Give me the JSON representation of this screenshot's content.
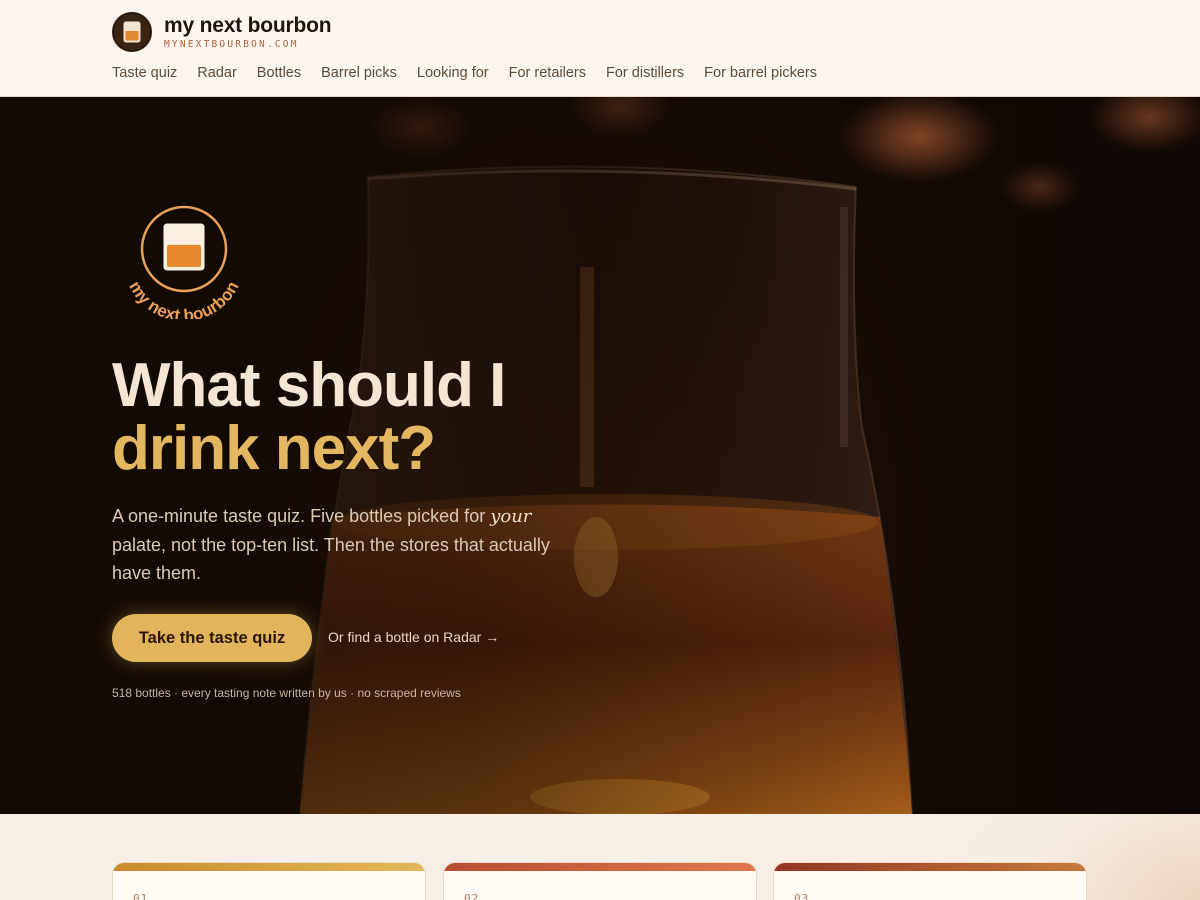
{
  "brand": {
    "name": "my next bourbon",
    "domain": "MYNEXTBOURBON.COM",
    "badge_text": "my next bourbon"
  },
  "nav": {
    "items": [
      {
        "label": "Taste quiz"
      },
      {
        "label": "Radar"
      },
      {
        "label": "Bottles"
      },
      {
        "label": "Barrel picks"
      },
      {
        "label": "Looking for"
      },
      {
        "label": "For retailers"
      },
      {
        "label": "For distillers"
      },
      {
        "label": "For barrel pickers"
      }
    ]
  },
  "hero": {
    "title_line1": "What should I",
    "title_line2": "drink next?",
    "subtitle_before": "A one-minute taste quiz. Five bottles picked for ",
    "subtitle_emphasis": "your",
    "subtitle_after": " palate, not the top-ten list. Then the stores that actually have them.",
    "cta_label": "Take the taste quiz",
    "secondary_link": "Or find a bottle on Radar →",
    "stats": "518 bottles · every tasting note written by us · no scraped reviews"
  },
  "cards": [
    {
      "number": "01",
      "accent": "#d9a444"
    },
    {
      "number": "02",
      "accent": "#c96a44"
    },
    {
      "number": "03",
      "accent": "#a84a2c"
    }
  ],
  "colors": {
    "accent_gold": "#e2b55d",
    "title_light": "#f4e6d2",
    "brand_orange": "#b0603a"
  }
}
